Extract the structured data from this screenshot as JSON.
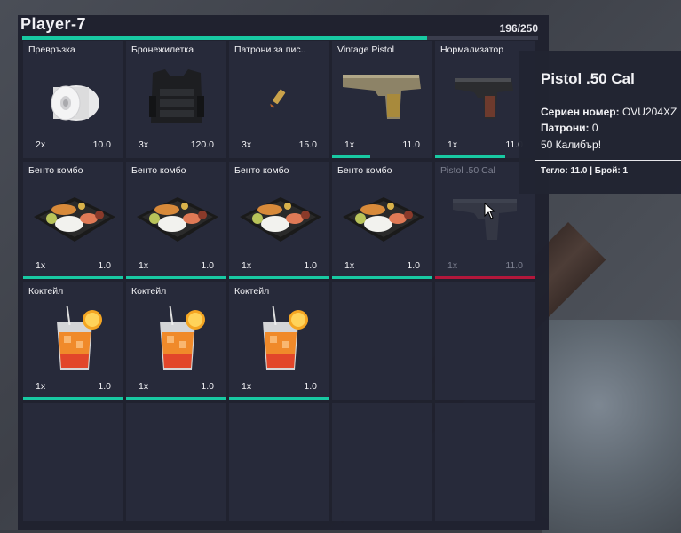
{
  "inventory": {
    "title": "Player-7",
    "weight": "196/250",
    "weight_fraction": 0.784,
    "accent_color": "#18c9a2",
    "warning_color": "#b3173b"
  },
  "slots": [
    {
      "name": "Превръзка",
      "qty": "2x",
      "weight": "10.0",
      "icon": "bandage-roll-icon",
      "bar": false
    },
    {
      "name": "Бронежилетка",
      "qty": "3x",
      "weight": "120.0",
      "icon": "body-armor-vest-icon",
      "bar": false
    },
    {
      "name": "Патрони за пис..",
      "qty": "3x",
      "weight": "15.0",
      "icon": "pistol-ammo-icon",
      "bar": false
    },
    {
      "name": "Vintage Pistol",
      "qty": "1x",
      "weight": "11.0",
      "icon": "vintage-pistol-icon",
      "bar": true,
      "bar_fraction": 0.38,
      "bar_color": "#18c9a2"
    },
    {
      "name": "Нормализатор",
      "qty": "1x",
      "weight": "11.0",
      "icon": "pistol-icon",
      "bar": true,
      "bar_fraction": 0.7,
      "bar_color": "#18c9a2"
    },
    {
      "name": "Бенто комбо",
      "qty": "1x",
      "weight": "1.0",
      "icon": "bento-box-icon",
      "bar": true,
      "bar_fraction": 1.0,
      "bar_color": "#18c9a2"
    },
    {
      "name": "Бенто комбо",
      "qty": "1x",
      "weight": "1.0",
      "icon": "bento-box-icon",
      "bar": true,
      "bar_fraction": 1.0,
      "bar_color": "#18c9a2"
    },
    {
      "name": "Бенто комбо",
      "qty": "1x",
      "weight": "1.0",
      "icon": "bento-box-icon",
      "bar": true,
      "bar_fraction": 1.0,
      "bar_color": "#18c9a2"
    },
    {
      "name": "Бенто комбо",
      "qty": "1x",
      "weight": "1.0",
      "icon": "bento-box-icon",
      "bar": true,
      "bar_fraction": 1.0,
      "bar_color": "#18c9a2"
    },
    {
      "name": "Pistol .50 Cal",
      "qty": "1x",
      "weight": "11.0",
      "icon": "desert-eagle-icon",
      "bar": true,
      "bar_fraction": 1.0,
      "bar_color": "#b3173b",
      "dim": true
    },
    {
      "name": "Коктейл",
      "qty": "1x",
      "weight": "1.0",
      "icon": "cocktail-glass-icon",
      "bar": true,
      "bar_fraction": 1.0,
      "bar_color": "#18c9a2"
    },
    {
      "name": "Коктейл",
      "qty": "1x",
      "weight": "1.0",
      "icon": "cocktail-glass-icon",
      "bar": true,
      "bar_fraction": 1.0,
      "bar_color": "#18c9a2"
    },
    {
      "name": "Коктейл",
      "qty": "1x",
      "weight": "1.0",
      "icon": "cocktail-glass-icon",
      "bar": true,
      "bar_fraction": 1.0,
      "bar_color": "#18c9a2"
    },
    {
      "name": "",
      "qty": "",
      "weight": "",
      "icon": "",
      "bar": false
    },
    {
      "name": "",
      "qty": "",
      "weight": "",
      "icon": "",
      "bar": false
    },
    {
      "name": "",
      "qty": "",
      "weight": "",
      "icon": "",
      "bar": false
    },
    {
      "name": "",
      "qty": "",
      "weight": "",
      "icon": "",
      "bar": false
    },
    {
      "name": "",
      "qty": "",
      "weight": "",
      "icon": "",
      "bar": false
    },
    {
      "name": "",
      "qty": "",
      "weight": "",
      "icon": "",
      "bar": false
    },
    {
      "name": "",
      "qty": "",
      "weight": "",
      "icon": "",
      "bar": false
    }
  ],
  "tooltip": {
    "title": "Pistol .50 Cal",
    "serial_label": "Сериен номер:",
    "serial_value": "OVU204XZ",
    "ammo_label": "Патрони:",
    "ammo_value": "0",
    "caliber": "50 Калибър!",
    "footer": "Тегло: 11.0 | Брой: 1"
  }
}
